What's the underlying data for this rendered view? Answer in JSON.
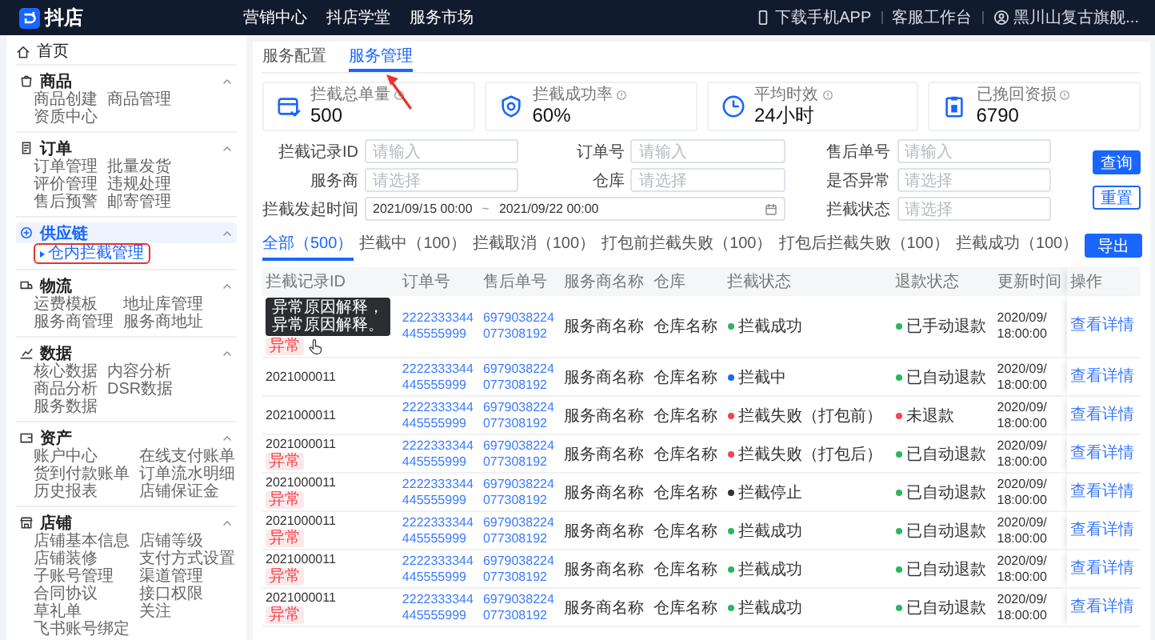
{
  "header": {
    "logo": "抖店",
    "nav": [
      "营销中心",
      "抖店学堂",
      "服务市场"
    ],
    "download": "下载手机APP",
    "service": "客服工作台",
    "shop": "黑川山复古旗舰..."
  },
  "sidebar": {
    "home": "首页",
    "sections": [
      {
        "label": "商品",
        "expanded": true,
        "selected": false,
        "children": [
          {
            "label": "商品创建",
            "selected": false,
            "highlighted": false
          },
          {
            "label": "商品管理",
            "selected": false,
            "highlighted": false
          },
          {
            "label": "资质中心",
            "selected": false,
            "highlighted": false
          }
        ]
      },
      {
        "label": "订单",
        "expanded": true,
        "selected": false,
        "children": [
          {
            "label": "订单管理",
            "selected": false,
            "highlighted": false
          },
          {
            "label": "批量发货",
            "selected": false,
            "highlighted": false
          },
          {
            "label": "评价管理",
            "selected": false,
            "highlighted": false
          },
          {
            "label": "违规处理",
            "selected": false,
            "highlighted": false
          },
          {
            "label": "售后预警",
            "selected": false,
            "highlighted": false
          },
          {
            "label": "邮寄管理",
            "selected": false,
            "highlighted": false
          }
        ]
      },
      {
        "label": "供应链",
        "expanded": true,
        "selected": true,
        "children": [
          {
            "label": "仓内拦截管理",
            "selected": true,
            "highlighted": true
          }
        ]
      },
      {
        "label": "物流",
        "expanded": true,
        "selected": false,
        "children": [
          {
            "label": "运费模板",
            "selected": false,
            "highlighted": false
          },
          {
            "label": "地址库管理",
            "selected": false,
            "highlighted": false
          },
          {
            "label": "服务商管理",
            "selected": false,
            "highlighted": false
          },
          {
            "label": "服务商地址",
            "selected": false,
            "highlighted": false
          }
        ]
      },
      {
        "label": "数据",
        "expanded": true,
        "selected": false,
        "children": [
          {
            "label": "核心数据",
            "selected": false,
            "highlighted": false
          },
          {
            "label": "内容分析",
            "selected": false,
            "highlighted": false
          },
          {
            "label": "商品分析",
            "selected": false,
            "highlighted": false
          },
          {
            "label": "DSR数据",
            "selected": false,
            "highlighted": false
          },
          {
            "label": "服务数据",
            "selected": false,
            "highlighted": false
          }
        ]
      },
      {
        "label": "资产",
        "expanded": true,
        "selected": false,
        "children": [
          {
            "label": "账户中心",
            "selected": false,
            "highlighted": false
          },
          {
            "label": "在线支付账单",
            "selected": false,
            "highlighted": false
          },
          {
            "label": "货到付款账单",
            "selected": false,
            "highlighted": false
          },
          {
            "label": "订单流水明细",
            "selected": false,
            "highlighted": false
          },
          {
            "label": "历史报表",
            "selected": false,
            "highlighted": false
          },
          {
            "label": "店铺保证金",
            "selected": false,
            "highlighted": false
          }
        ]
      },
      {
        "label": "店铺",
        "expanded": true,
        "selected": false,
        "children": [
          {
            "label": "店铺基本信息",
            "selected": false,
            "highlighted": false
          },
          {
            "label": "店铺等级",
            "selected": false,
            "highlighted": false
          },
          {
            "label": "店铺装修",
            "selected": false,
            "highlighted": false
          },
          {
            "label": "支付方式设置",
            "selected": false,
            "highlighted": false
          },
          {
            "label": "子账号管理",
            "selected": false,
            "highlighted": false
          },
          {
            "label": "渠道管理",
            "selected": false,
            "highlighted": false
          },
          {
            "label": "合同协议",
            "selected": false,
            "highlighted": false
          },
          {
            "label": "接口权限",
            "selected": false,
            "highlighted": false
          },
          {
            "label": "草礼单",
            "selected": false,
            "highlighted": false
          },
          {
            "label": "关注",
            "selected": false,
            "highlighted": false
          },
          {
            "label": "飞书账号绑定",
            "selected": false,
            "highlighted": false
          }
        ]
      }
    ]
  },
  "tabs": [
    {
      "label": "服务配置",
      "selected": false,
      "highlighted": false
    },
    {
      "label": "服务管理",
      "selected": true,
      "highlighted": true
    }
  ],
  "stats": [
    {
      "label": "拦截总单量",
      "value": "500"
    },
    {
      "label": "拦截成功率",
      "value": "60%"
    },
    {
      "label": "平均时效",
      "value": "24小时"
    },
    {
      "label": "已挽回资损",
      "value": "6790"
    }
  ],
  "filters": [
    {
      "kind": "input",
      "label": "拦截记录ID",
      "placeholder": "请输入"
    },
    {
      "kind": "input",
      "label": "订单号",
      "placeholder": "请输入"
    },
    {
      "kind": "input",
      "label": "售后单号",
      "placeholder": "请输入"
    },
    {
      "kind": "select",
      "label": "服务商",
      "placeholder": "请选择"
    },
    {
      "kind": "select",
      "label": "仓库",
      "placeholder": "请选择"
    },
    {
      "kind": "select",
      "label": "是否异常",
      "placeholder": "请选择"
    },
    {
      "kind": "daterange",
      "label": "拦截发起时间",
      "start": "2021/09/15 00:00",
      "separator": "~",
      "end": "2021/09/22 00:00"
    },
    {
      "kind": "select",
      "label": "拦截状态",
      "placeholder": "请选择"
    }
  ],
  "buttons": [
    {
      "kind": "primary",
      "label": "查询"
    },
    {
      "kind": "default",
      "label": "重置"
    }
  ],
  "status_tabs": [
    {
      "label": "全部（500）",
      "selected": true
    },
    {
      "label": "拦截中（100）",
      "selected": false
    },
    {
      "label": "拦截取消（100）",
      "selected": false
    },
    {
      "label": "打包前拦截失败（100）",
      "selected": false
    },
    {
      "label": "打包后拦截失败（100）",
      "selected": false
    },
    {
      "label": "拦截成功（100）",
      "selected": false
    }
  ],
  "export_button": "导出",
  "table": {
    "columns": [
      "拦截记录ID",
      "订单号",
      "售后单号",
      "服务商名称",
      "仓库",
      "拦截状态",
      "退款状态",
      "更新时间",
      "操作"
    ],
    "rows": [
      {
        "tooltip": "异常原因解释，异常原因解释。",
        "tag": "异常",
        "order_no": [
          "2222333344",
          "445555999"
        ],
        "after_sale_no": [
          "6979038224",
          "077308192"
        ],
        "provider": "服务商名称",
        "warehouse": "仓库名称",
        "status": {
          "label": "拦截成功",
          "color": "#2db55d"
        },
        "refund": {
          "label": "已手动退款",
          "color": "#2db55d"
        },
        "time": [
          "2020/09/",
          "18:00:00"
        ],
        "action": "查看详情"
      },
      {
        "id": "2021000011",
        "order_no": [
          "2222333344",
          "445555999"
        ],
        "after_sale_no": [
          "6979038224",
          "077308192"
        ],
        "provider": "服务商名称",
        "warehouse": "仓库名称",
        "status": {
          "label": "拦截中",
          "color": "#1966ff"
        },
        "refund": {
          "label": "已自动退款",
          "color": "#2db55d"
        },
        "time": [
          "2020/09/",
          "18:00:00"
        ],
        "action": "查看详情"
      },
      {
        "id": "2021000011",
        "order_no": [
          "2222333344",
          "445555999"
        ],
        "after_sale_no": [
          "6979038224",
          "077308192"
        ],
        "provider": "服务商名称",
        "warehouse": "仓库名称",
        "status": {
          "label": "拦截失败（打包前）",
          "color": "#f2454d"
        },
        "refund": {
          "label": "未退款",
          "color": "#f2454d"
        },
        "time": [
          "2020/09/",
          "18:00:00"
        ],
        "action": "查看详情"
      },
      {
        "id": "2021000011",
        "tag": "异常",
        "order_no": [
          "2222333344",
          "445555999"
        ],
        "after_sale_no": [
          "6979038224",
          "077308192"
        ],
        "provider": "服务商名称",
        "warehouse": "仓库名称",
        "status": {
          "label": "拦截失败（打包后）",
          "color": "#f2454d"
        },
        "refund": {
          "label": "已自动退款",
          "color": "#2db55d"
        },
        "time": [
          "2020/09/",
          "18:00:00"
        ],
        "action": "查看详情"
      },
      {
        "id": "2021000011",
        "tag": "异常",
        "order_no": [
          "2222333344",
          "445555999"
        ],
        "after_sale_no": [
          "6979038224",
          "077308192"
        ],
        "provider": "服务商名称",
        "warehouse": "仓库名称",
        "status": {
          "label": "拦截停止",
          "color": "#333333"
        },
        "refund": {
          "label": "已自动退款",
          "color": "#2db55d"
        },
        "time": [
          "2020/09/",
          "18:00:00"
        ],
        "action": "查看详情"
      },
      {
        "id": "2021000011",
        "tag": "异常",
        "order_no": [
          "2222333344",
          "445555999"
        ],
        "after_sale_no": [
          "6979038224",
          "077308192"
        ],
        "provider": "服务商名称",
        "warehouse": "仓库名称",
        "status": {
          "label": "拦截成功",
          "color": "#2db55d"
        },
        "refund": {
          "label": "已自动退款",
          "color": "#2db55d"
        },
        "time": [
          "2020/09/",
          "18:00:00"
        ],
        "action": "查看详情"
      },
      {
        "id": "2021000011",
        "tag": "异常",
        "order_no": [
          "2222333344",
          "445555999"
        ],
        "after_sale_no": [
          "6979038224",
          "077308192"
        ],
        "provider": "服务商名称",
        "warehouse": "仓库名称",
        "status": {
          "label": "拦截成功",
          "color": "#2db55d"
        },
        "refund": {
          "label": "已自动退款",
          "color": "#2db55d"
        },
        "time": [
          "2020/09/",
          "18:00:00"
        ],
        "action": "查看详情"
      },
      {
        "id": "2021000011",
        "tag": "异常",
        "order_no": [
          "2222333344",
          "445555999"
        ],
        "after_sale_no": [
          "6979038224",
          "077308192"
        ],
        "provider": "服务商名称",
        "warehouse": "仓库名称",
        "status": {
          "label": "拦截成功",
          "color": "#2db55d"
        },
        "refund": {
          "label": "已自动退款",
          "color": "#2db55d"
        },
        "time": [
          "2020/09/",
          "18:00:00"
        ],
        "action": "查看详情"
      }
    ]
  }
}
